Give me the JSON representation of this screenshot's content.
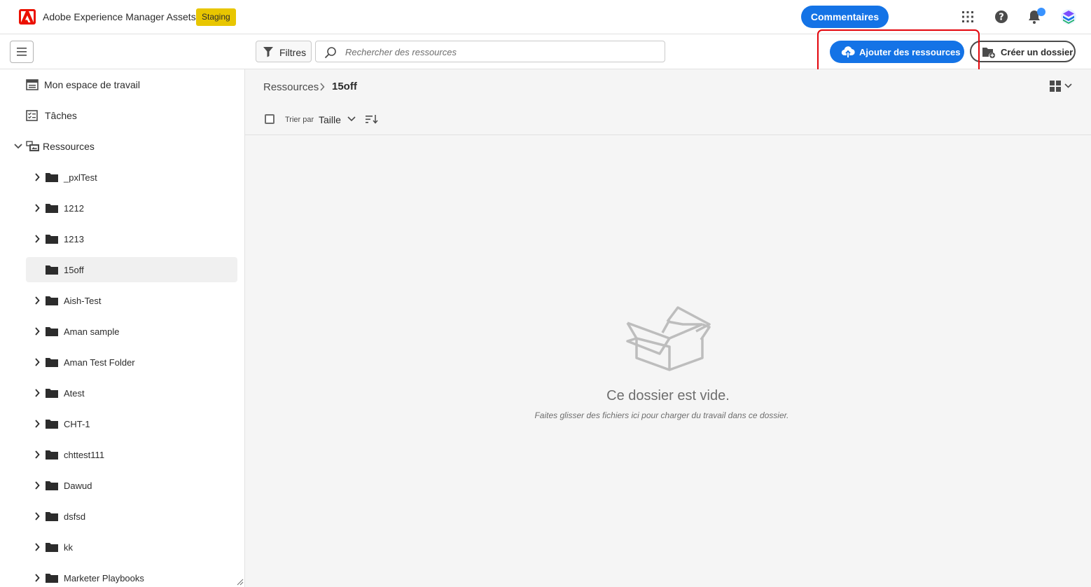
{
  "header": {
    "app_title": "Adobe Experience Manager Assets",
    "env_badge": "Staging",
    "feedback_label": "Commentaires",
    "brand_color": "#eb1000",
    "accent_color": "#1473e6",
    "icons": [
      "apps-grid-icon",
      "help-icon",
      "notification-bell-icon",
      "user-avatar-icon"
    ]
  },
  "toolbar": {
    "filters_label": "Filtres",
    "search_placeholder": "Rechercher des ressources",
    "add_assets_label": "Ajouter des ressources",
    "create_folder_label": "Créer un dossier",
    "highlight_color": "#e3050c"
  },
  "sidebar": {
    "nav": [
      {
        "label": "Mon espace de travail",
        "icon": "workspace-icon"
      },
      {
        "label": "Tâches",
        "icon": "tasks-icon"
      },
      {
        "label": "Ressources",
        "icon": "assets-icon",
        "expanded": true
      }
    ],
    "folders": [
      {
        "label": "_pxlTest",
        "has_children": true,
        "selected": false
      },
      {
        "label": "1212",
        "has_children": true,
        "selected": false
      },
      {
        "label": "1213",
        "has_children": true,
        "selected": false
      },
      {
        "label": "15off",
        "has_children": false,
        "selected": true
      },
      {
        "label": "Aish-Test",
        "has_children": true,
        "selected": false
      },
      {
        "label": "Aman sample",
        "has_children": true,
        "selected": false
      },
      {
        "label": "Aman Test Folder",
        "has_children": true,
        "selected": false
      },
      {
        "label": "Atest",
        "has_children": true,
        "selected": false
      },
      {
        "label": "CHT-1",
        "has_children": true,
        "selected": false
      },
      {
        "label": "chttest111",
        "has_children": true,
        "selected": false
      },
      {
        "label": "Dawud",
        "has_children": true,
        "selected": false
      },
      {
        "label": "dsfsd",
        "has_children": true,
        "selected": false
      },
      {
        "label": "kk",
        "has_children": true,
        "selected": false
      },
      {
        "label": "Marketer Playbooks",
        "has_children": true,
        "selected": false
      }
    ]
  },
  "main": {
    "breadcrumb_root": "Ressources",
    "breadcrumb_current": "15off",
    "sort_by_label": "Trier par",
    "sort_by_value": "Taille",
    "empty_title": "Ce dossier est vide.",
    "empty_subtitle": "Faites glisser des fichiers ici pour charger du travail dans ce dossier."
  }
}
